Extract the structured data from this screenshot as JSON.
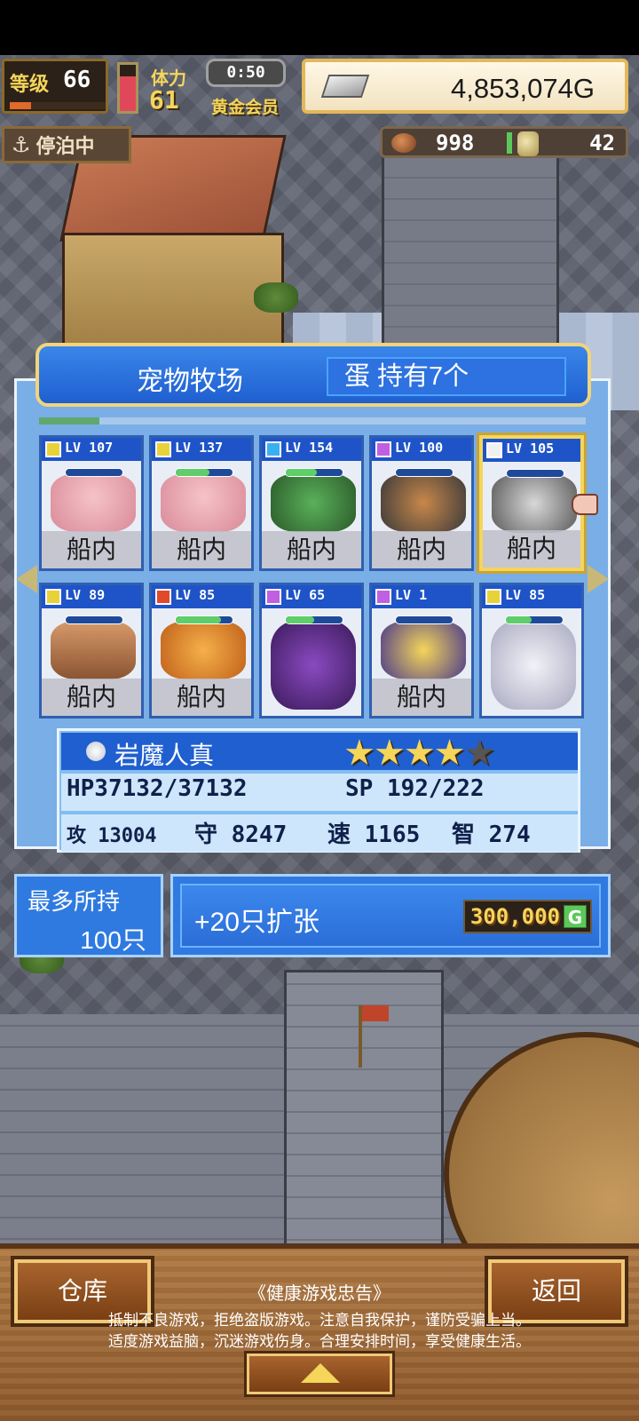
{
  "hud": {
    "level_label": "等级",
    "level_value": "66",
    "xp_fraction": 0.22,
    "stamina_label": "体力",
    "stamina_value": "61",
    "stamina_fraction": 0.75,
    "timer": "0:50",
    "membership": "黄金会员",
    "gold": "4,853,074G",
    "moored_label": "停泊中",
    "resource_1": "998",
    "resource_2": "42"
  },
  "ranch": {
    "title": "宠物牧场",
    "eggs": "蛋 持有7个",
    "scroll_fraction": 0.11,
    "pets": [
      {
        "level": "LV 107",
        "element": "yellow",
        "location": "船内",
        "hp_fraction": 0.0
      },
      {
        "level": "LV 137",
        "element": "yellow",
        "location": "船内",
        "hp_fraction": 0.6
      },
      {
        "level": "LV 154",
        "element": "blue",
        "location": "船内",
        "hp_fraction": 0.55
      },
      {
        "level": "LV 100",
        "element": "purple",
        "location": "船内",
        "hp_fraction": 0.0
      },
      {
        "level": "LV 105",
        "element": "white",
        "location": "船内",
        "hp_fraction": 0.0,
        "selected": true
      },
      {
        "level": "LV 89",
        "element": "yellow",
        "location": "船内",
        "hp_fraction": 0.0
      },
      {
        "level": "LV 85",
        "element": "red",
        "location": "船内",
        "hp_fraction": 0.8
      },
      {
        "level": "LV 65",
        "element": "purple",
        "location": "",
        "hp_fraction": 0.5
      },
      {
        "level": "LV 1",
        "element": "purple",
        "location": "船内",
        "hp_fraction": 0.0
      },
      {
        "level": "LV 85",
        "element": "yellow",
        "location": "",
        "hp_fraction": 0.45
      }
    ]
  },
  "detail": {
    "name": "岩魔人真",
    "stars_filled": 4,
    "stars_total": 5,
    "hp": "HP37132/37132",
    "sp": "SP 192/222",
    "atk": "攻 13004",
    "def": "守 8247",
    "spd": "速 1165",
    "int": "智 274"
  },
  "capacity": {
    "label": "最多所持",
    "value": "100只"
  },
  "expand": {
    "label": "+20只扩张",
    "price": "300,000",
    "currency": "G"
  },
  "bottom": {
    "warehouse": "仓库",
    "back": "返回",
    "notice_title": "《健康游戏忠告》",
    "notice_line1": "抵制不良游戏，拒绝盗版游戏。注意自我保护，谨防受骗上当。",
    "notice_line2": "适度游戏益脑，沉迷游戏伤身。合理安排时间，享受健康生活。"
  },
  "colors": {
    "panel_blue": "#1f5fd0",
    "gold_accent": "#f5d55a",
    "element_yellow": "#e8d23a",
    "element_blue": "#3ab0f0",
    "element_purple": "#c060e0",
    "element_red": "#e04a2a",
    "element_white": "#f0f0f0"
  }
}
